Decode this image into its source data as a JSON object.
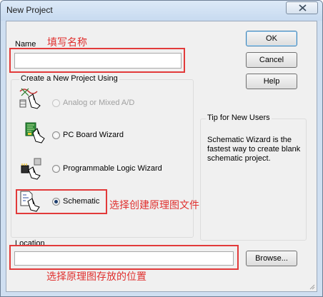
{
  "window": {
    "title": "New Project"
  },
  "name_field": {
    "label": "Name",
    "value": ""
  },
  "project_type_group": {
    "title": "Create a New Project Using",
    "options": [
      {
        "label": "Analog or Mixed A/D",
        "selected": false,
        "enabled": false,
        "icon": "analog-wizard-icon"
      },
      {
        "label": "PC Board Wizard",
        "selected": false,
        "enabled": true,
        "icon": "pcb-board-icon"
      },
      {
        "label": "Programmable Logic Wizard",
        "selected": false,
        "enabled": true,
        "icon": "programmable-logic-icon"
      },
      {
        "label": "Schematic",
        "selected": true,
        "enabled": true,
        "icon": "schematic-icon"
      }
    ]
  },
  "tip_group": {
    "title": "Tip for New Users",
    "text": "Schematic Wizard is the fastest way to create blank schematic project."
  },
  "location_field": {
    "label": "Location",
    "value": ""
  },
  "buttons": {
    "ok": "OK",
    "cancel": "Cancel",
    "help": "Help",
    "browse": "Browse..."
  },
  "annotations": {
    "name": "填写名称",
    "schematic": "选择创建原理图文件",
    "location": "选择原理图存放的位置"
  },
  "colors": {
    "annotation": "#e0302e",
    "window_frame": "#cfdff1",
    "dialog_bg": "#f0f0f0"
  }
}
